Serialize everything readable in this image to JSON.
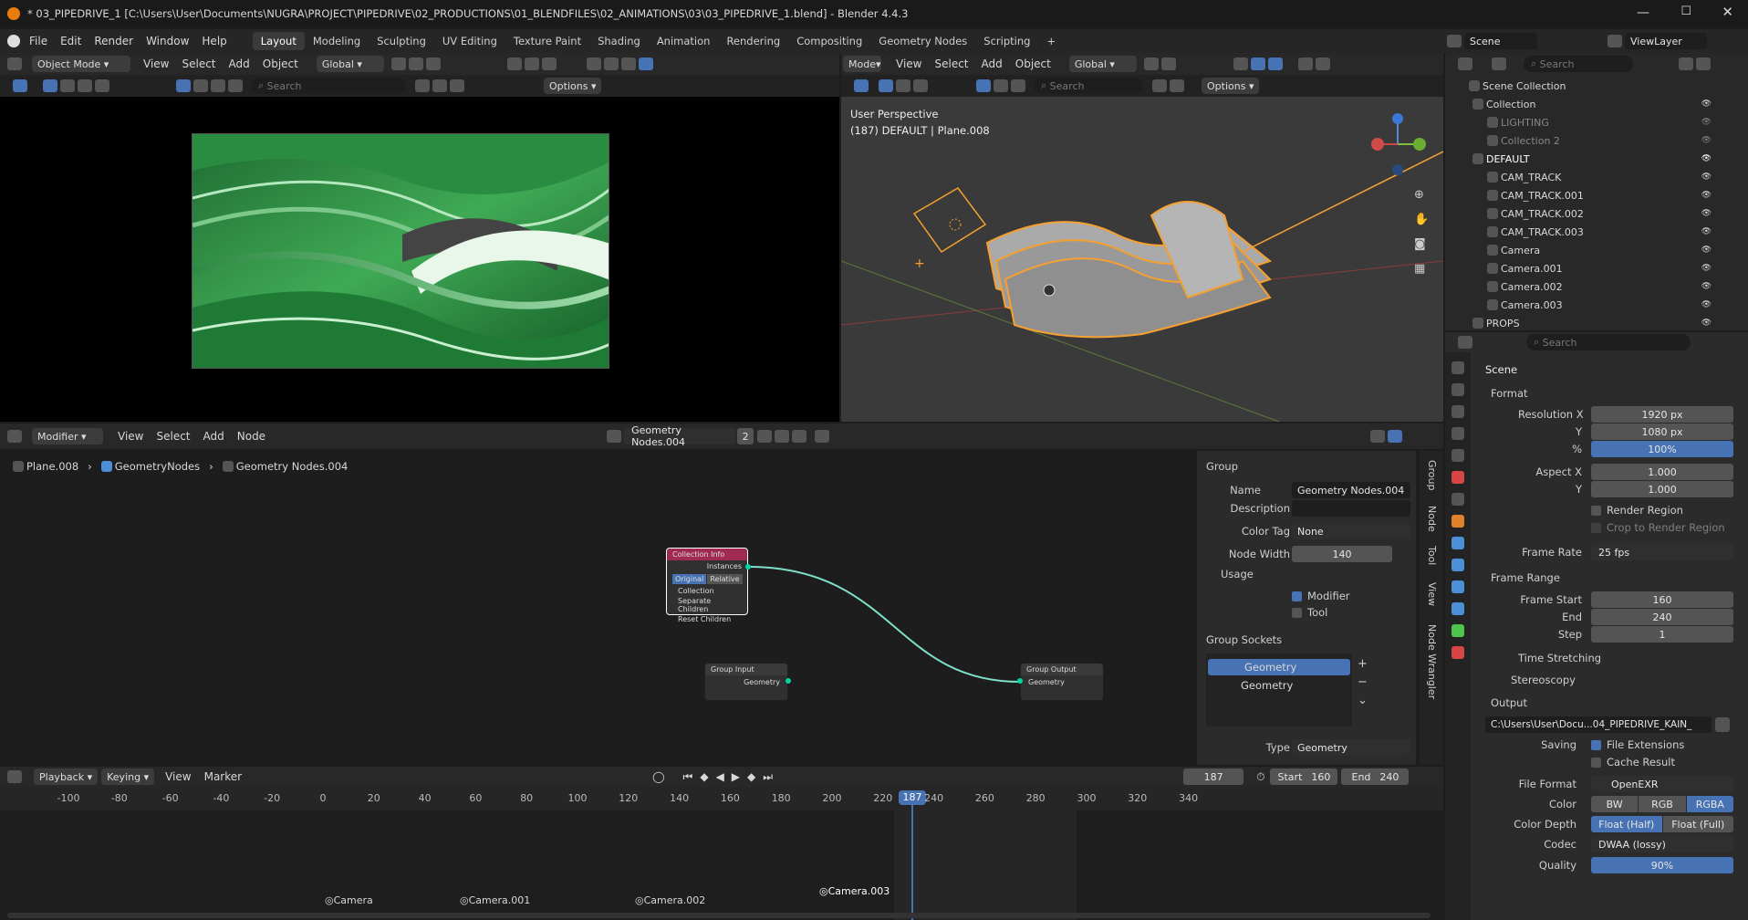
{
  "window": {
    "title": "* 03_PIPEDRIVE_1 [C:\\Users\\User\\Documents\\NUGRA\\PROJECT\\PIPEDRIVE\\02_PRODUCTIONS\\01_BLENDFILES\\02_ANIMATIONS\\03\\03_PIPEDRIVE_1.blend] - Blender 4.4.3"
  },
  "menu": [
    "File",
    "Edit",
    "Render",
    "Window",
    "Help"
  ],
  "workspaces": [
    "Layout",
    "Modeling",
    "Sculpting",
    "UV Editing",
    "Texture Paint",
    "Shading",
    "Animation",
    "Rendering",
    "Compositing",
    "Geometry Nodes",
    "Scripting"
  ],
  "scene": {
    "name": "Scene",
    "view_layer": "ViewLayer"
  },
  "left_view": {
    "mode": "Object Mode",
    "menus": [
      "View",
      "Select",
      "Add",
      "Object"
    ],
    "orientation": "Global",
    "search_placeholder": "Search",
    "options": "Options"
  },
  "right_view": {
    "mode": "Mode",
    "menus": [
      "View",
      "Select",
      "Add",
      "Object"
    ],
    "orientation": "Global",
    "search_placeholder": "Search",
    "options": "Options",
    "perspective": "User Perspective",
    "info": "(187) DEFAULT | Plane.008"
  },
  "outliner": {
    "search_placeholder": "Search",
    "root": "Scene Collection",
    "items": [
      {
        "label": "Collection",
        "level": 1
      },
      {
        "label": "LIGHTING",
        "level": 2
      },
      {
        "label": "Collection 2",
        "level": 2
      },
      {
        "label": "DEFAULT",
        "level": 1
      },
      {
        "label": "CAM_TRACK",
        "level": 2
      },
      {
        "label": "CAM_TRACK.001",
        "level": 2
      },
      {
        "label": "CAM_TRACK.002",
        "level": 2
      },
      {
        "label": "CAM_TRACK.003",
        "level": 2
      },
      {
        "label": "Camera",
        "level": 2
      },
      {
        "label": "Camera.001",
        "level": 2
      },
      {
        "label": "Camera.002",
        "level": 2
      },
      {
        "label": "Camera.003",
        "level": 2
      },
      {
        "label": "PROPS",
        "level": 1
      }
    ]
  },
  "node_editor": {
    "editor": "Modifier",
    "menus": [
      "View",
      "Select",
      "Add",
      "Node"
    ],
    "tree_name": "Geometry Nodes.004",
    "users": "2",
    "breadcrumb": [
      "Plane.008",
      "GeometryNodes",
      "Geometry Nodes.004"
    ],
    "nodes": {
      "collection_info": {
        "title": "Collection Info",
        "out": "Instances",
        "opt1": "Original",
        "opt2": "Relative",
        "collection": "Collection",
        "sep": "Separate Children",
        "reset": "Reset Children"
      },
      "group_input": {
        "title": "Group Input",
        "sock": "Geometry"
      },
      "group_output": {
        "title": "Group Output",
        "sock": "Geometry"
      }
    }
  },
  "group_panel": {
    "header": "Group",
    "name_label": "Name",
    "name_value": "Geometry Nodes.004",
    "desc_label": "Description",
    "colortag_label": "Color Tag",
    "colortag_value": "None",
    "nodewidth_label": "Node Width",
    "nodewidth_value": "140",
    "usage_label": "Usage",
    "modifier": "Modifier",
    "tool": "Tool",
    "sockets_header": "Group Sockets",
    "sock1": "Geometry",
    "sock2": "Geometry",
    "type_label": "Type",
    "type_value": "Geometry",
    "tabs": [
      "Group",
      "Node",
      "Tool",
      "View",
      "Node Wrangler"
    ]
  },
  "properties": {
    "search_placeholder": "Search",
    "context": "Scene",
    "format": "Format",
    "res_x_label": "Resolution X",
    "res_x": "1920 px",
    "res_y_label": "Y",
    "res_y": "1080 px",
    "pct_label": "%",
    "pct": "100%",
    "aspect_x_label": "Aspect X",
    "aspect_x": "1.000",
    "aspect_y_label": "Y",
    "aspect_y": "1.000",
    "render_region": "Render Region",
    "crop": "Crop to Render Region",
    "fps_label": "Frame Rate",
    "fps": "25 fps",
    "frame_range": "Frame Range",
    "start_label": "Frame Start",
    "start": "160",
    "end_label": "End",
    "end": "240",
    "step_label": "Step",
    "step": "1",
    "time_stretch": "Time Stretching",
    "stereo": "Stereoscopy",
    "output": "Output",
    "path": "C:\\Users\\User\\Docu...04_PIPEDRIVE_KAIN_",
    "saving_label": "Saving",
    "file_ext": "File Extensions",
    "cache": "Cache Result",
    "format_label": "File Format",
    "format_value": "OpenEXR",
    "color_label": "Color",
    "color_opts": [
      "BW",
      "RGB",
      "RGBA"
    ],
    "depth_label": "Color Depth",
    "depth_opts": [
      "Float (Half)",
      "Float (Full)"
    ],
    "codec_label": "Codec",
    "codec": "DWAA (lossy)",
    "quality_label": "Quality",
    "quality": "90%"
  },
  "timeline": {
    "menus": [
      "Playback",
      "Keying",
      "View",
      "Marker"
    ],
    "current": "187",
    "start_label": "Start",
    "start": "160",
    "end_label": "End",
    "end": "240",
    "ticks": [
      "-100",
      "-80",
      "-60",
      "-40",
      "-20",
      "0",
      "20",
      "40",
      "60",
      "80",
      "100",
      "120",
      "140",
      "160",
      "180",
      "200",
      "220",
      "240",
      "260",
      "280",
      "300",
      "320",
      "340"
    ],
    "markers": [
      "Camera",
      "Camera.001",
      "Camera.002",
      "Camera.003"
    ]
  }
}
